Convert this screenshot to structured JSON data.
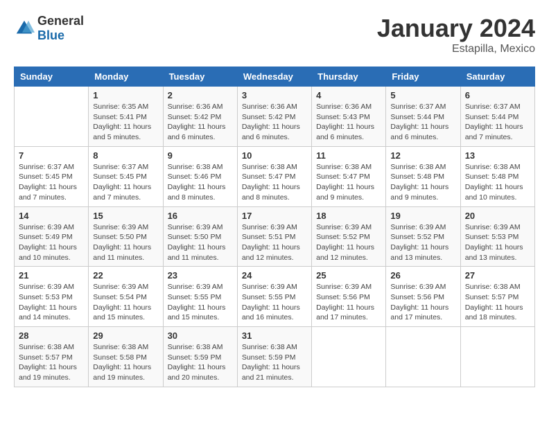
{
  "header": {
    "logo_general": "General",
    "logo_blue": "Blue",
    "month": "January 2024",
    "location": "Estapilla, Mexico"
  },
  "weekdays": [
    "Sunday",
    "Monday",
    "Tuesday",
    "Wednesday",
    "Thursday",
    "Friday",
    "Saturday"
  ],
  "weeks": [
    [
      {
        "day": "",
        "detail": ""
      },
      {
        "day": "1",
        "detail": "Sunrise: 6:35 AM\nSunset: 5:41 PM\nDaylight: 11 hours\nand 5 minutes."
      },
      {
        "day": "2",
        "detail": "Sunrise: 6:36 AM\nSunset: 5:42 PM\nDaylight: 11 hours\nand 6 minutes."
      },
      {
        "day": "3",
        "detail": "Sunrise: 6:36 AM\nSunset: 5:42 PM\nDaylight: 11 hours\nand 6 minutes."
      },
      {
        "day": "4",
        "detail": "Sunrise: 6:36 AM\nSunset: 5:43 PM\nDaylight: 11 hours\nand 6 minutes."
      },
      {
        "day": "5",
        "detail": "Sunrise: 6:37 AM\nSunset: 5:44 PM\nDaylight: 11 hours\nand 6 minutes."
      },
      {
        "day": "6",
        "detail": "Sunrise: 6:37 AM\nSunset: 5:44 PM\nDaylight: 11 hours\nand 7 minutes."
      }
    ],
    [
      {
        "day": "7",
        "detail": "Sunrise: 6:37 AM\nSunset: 5:45 PM\nDaylight: 11 hours\nand 7 minutes."
      },
      {
        "day": "8",
        "detail": "Sunrise: 6:37 AM\nSunset: 5:45 PM\nDaylight: 11 hours\nand 7 minutes."
      },
      {
        "day": "9",
        "detail": "Sunrise: 6:38 AM\nSunset: 5:46 PM\nDaylight: 11 hours\nand 8 minutes."
      },
      {
        "day": "10",
        "detail": "Sunrise: 6:38 AM\nSunset: 5:47 PM\nDaylight: 11 hours\nand 8 minutes."
      },
      {
        "day": "11",
        "detail": "Sunrise: 6:38 AM\nSunset: 5:47 PM\nDaylight: 11 hours\nand 9 minutes."
      },
      {
        "day": "12",
        "detail": "Sunrise: 6:38 AM\nSunset: 5:48 PM\nDaylight: 11 hours\nand 9 minutes."
      },
      {
        "day": "13",
        "detail": "Sunrise: 6:38 AM\nSunset: 5:48 PM\nDaylight: 11 hours\nand 10 minutes."
      }
    ],
    [
      {
        "day": "14",
        "detail": "Sunrise: 6:39 AM\nSunset: 5:49 PM\nDaylight: 11 hours\nand 10 minutes."
      },
      {
        "day": "15",
        "detail": "Sunrise: 6:39 AM\nSunset: 5:50 PM\nDaylight: 11 hours\nand 11 minutes."
      },
      {
        "day": "16",
        "detail": "Sunrise: 6:39 AM\nSunset: 5:50 PM\nDaylight: 11 hours\nand 11 minutes."
      },
      {
        "day": "17",
        "detail": "Sunrise: 6:39 AM\nSunset: 5:51 PM\nDaylight: 11 hours\nand 12 minutes."
      },
      {
        "day": "18",
        "detail": "Sunrise: 6:39 AM\nSunset: 5:52 PM\nDaylight: 11 hours\nand 12 minutes."
      },
      {
        "day": "19",
        "detail": "Sunrise: 6:39 AM\nSunset: 5:52 PM\nDaylight: 11 hours\nand 13 minutes."
      },
      {
        "day": "20",
        "detail": "Sunrise: 6:39 AM\nSunset: 5:53 PM\nDaylight: 11 hours\nand 13 minutes."
      }
    ],
    [
      {
        "day": "21",
        "detail": "Sunrise: 6:39 AM\nSunset: 5:53 PM\nDaylight: 11 hours\nand 14 minutes."
      },
      {
        "day": "22",
        "detail": "Sunrise: 6:39 AM\nSunset: 5:54 PM\nDaylight: 11 hours\nand 15 minutes."
      },
      {
        "day": "23",
        "detail": "Sunrise: 6:39 AM\nSunset: 5:55 PM\nDaylight: 11 hours\nand 15 minutes."
      },
      {
        "day": "24",
        "detail": "Sunrise: 6:39 AM\nSunset: 5:55 PM\nDaylight: 11 hours\nand 16 minutes."
      },
      {
        "day": "25",
        "detail": "Sunrise: 6:39 AM\nSunset: 5:56 PM\nDaylight: 11 hours\nand 17 minutes."
      },
      {
        "day": "26",
        "detail": "Sunrise: 6:39 AM\nSunset: 5:56 PM\nDaylight: 11 hours\nand 17 minutes."
      },
      {
        "day": "27",
        "detail": "Sunrise: 6:38 AM\nSunset: 5:57 PM\nDaylight: 11 hours\nand 18 minutes."
      }
    ],
    [
      {
        "day": "28",
        "detail": "Sunrise: 6:38 AM\nSunset: 5:57 PM\nDaylight: 11 hours\nand 19 minutes."
      },
      {
        "day": "29",
        "detail": "Sunrise: 6:38 AM\nSunset: 5:58 PM\nDaylight: 11 hours\nand 19 minutes."
      },
      {
        "day": "30",
        "detail": "Sunrise: 6:38 AM\nSunset: 5:59 PM\nDaylight: 11 hours\nand 20 minutes."
      },
      {
        "day": "31",
        "detail": "Sunrise: 6:38 AM\nSunset: 5:59 PM\nDaylight: 11 hours\nand 21 minutes."
      },
      {
        "day": "",
        "detail": ""
      },
      {
        "day": "",
        "detail": ""
      },
      {
        "day": "",
        "detail": ""
      }
    ]
  ]
}
